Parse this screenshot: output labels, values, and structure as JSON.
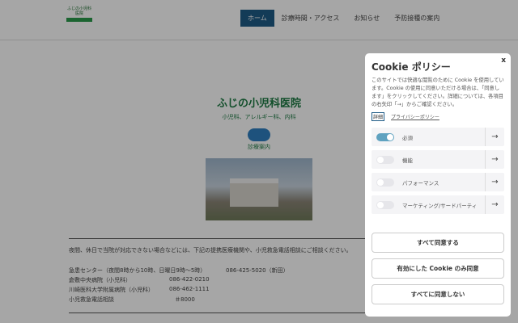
{
  "header": {
    "logo_text": "ふじの小児科医院",
    "nav": [
      {
        "label": "ホーム",
        "active": true
      },
      {
        "label": "診療時間・アクセス"
      },
      {
        "label": "お知らせ"
      },
      {
        "label": "予防接種の案内"
      }
    ]
  },
  "hero": {
    "title": "ふじの小児科医院",
    "subtitle": "小児科、アレルギー科、内科",
    "caption": "診療案内"
  },
  "main": {
    "intro": "夜間、休日で当院が対応できない場合などには、下記の提携医療機関や、小児救急電話相談にご相談ください。",
    "contacts": [
      {
        "name": "急患センター（夜間8時から10時、日曜日9時〜5時）",
        "phone": "086-425-5020（新田）"
      },
      {
        "name": "倉敷中央病院（小児科）",
        "phone": "086-422-0210"
      },
      {
        "name": "川崎医科大学附属病院（小児科）",
        "phone": "086-462-1111"
      },
      {
        "name": "小児救急電話相談",
        "phone": "＃8000"
      }
    ]
  },
  "cookie": {
    "title": "Cookie ポリシー",
    "close": "x",
    "description": "このサイトでは快適な閲覧のために Cookie を使用しています。Cookie の使用に同意いただける場合は、「同意します」をクリックしてください。詳細については、各項目の右矢印「→」からご確認ください。",
    "details_label": "詳細",
    "privacy_link": "プライバシーポリシー",
    "categories": [
      {
        "label": "必須",
        "enabled": true
      },
      {
        "label": "機能",
        "enabled": false
      },
      {
        "label": "パフォーマンス",
        "enabled": false
      },
      {
        "label": "マーケティング/サードパーティ",
        "enabled": false
      }
    ],
    "arrow": "→",
    "buttons": [
      "すべて同意する",
      "有効にした Cookie のみ同意",
      "すべてに同意しない"
    ]
  }
}
